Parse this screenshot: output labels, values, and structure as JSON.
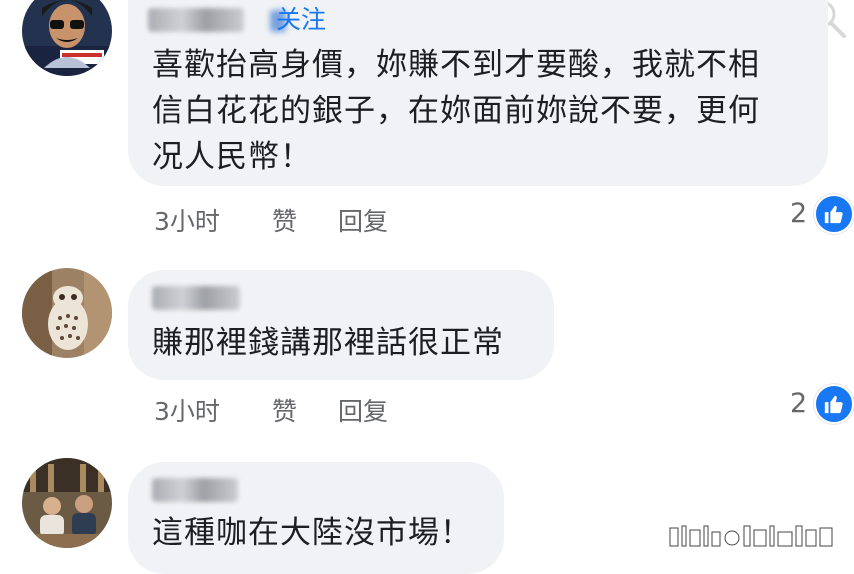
{
  "comments": [
    {
      "follow_label": "关注",
      "text_lines": [
        "喜歡抬高身價，妳賺不到才要酸，我就不相",
        "信白花花的銀子，在妳面前妳說不要，更何",
        "况人民幣！"
      ],
      "time": "3小时",
      "like_label": "赞",
      "reply_label": "回复",
      "reaction_count": "2"
    },
    {
      "text_lines": [
        "賺那裡錢講那裡話很正常"
      ],
      "time": "3小时",
      "like_label": "赞",
      "reply_label": "回复",
      "reaction_count": "2"
    },
    {
      "text_lines": [
        "這種咖在大陸沒市場！"
      ]
    }
  ],
  "colors": {
    "accent": "#1877f2",
    "bubble": "#f0f2f5",
    "meta": "#65676b"
  },
  "icons": [
    "thumbs-up-icon",
    "search-icon"
  ]
}
